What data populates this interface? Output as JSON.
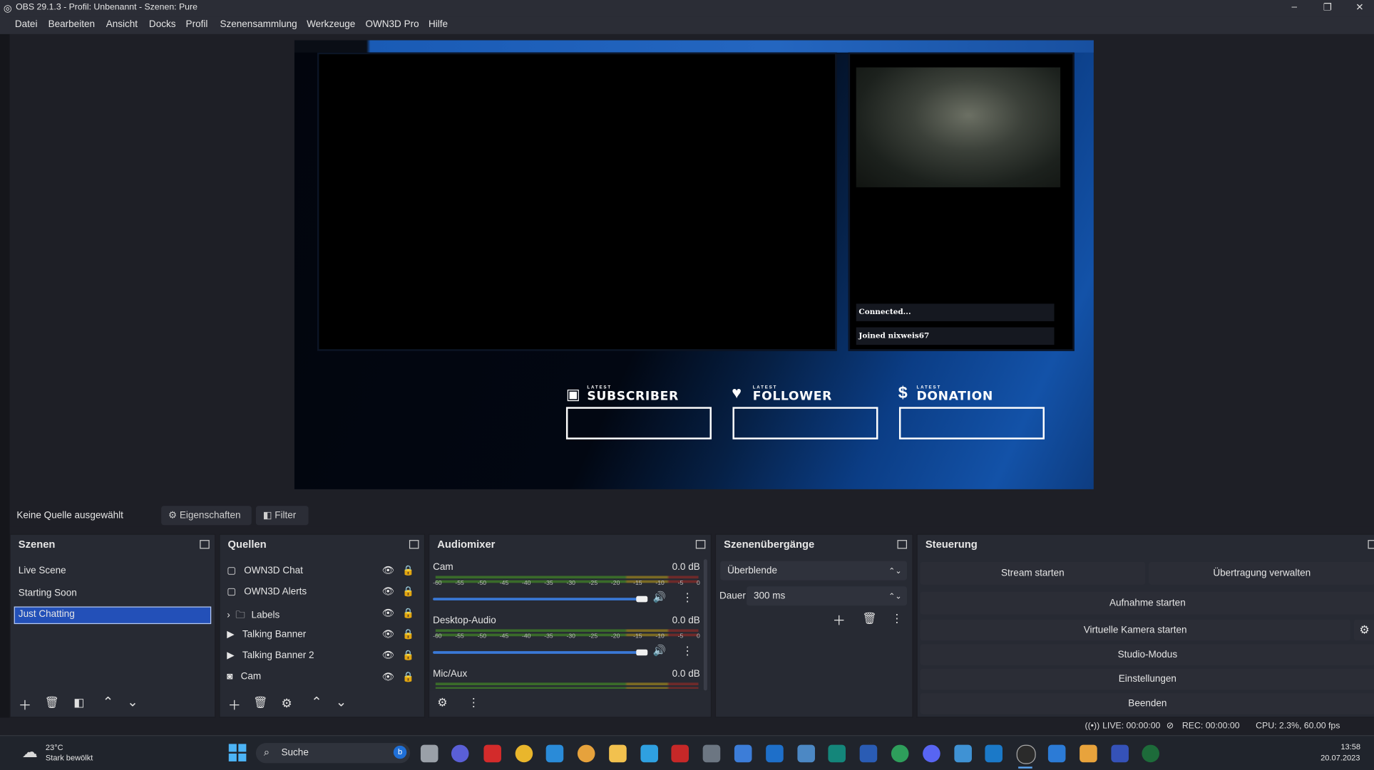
{
  "window": {
    "title": "OBS 29.1.3 - Profil: Unbenannt - Szenen: Pure"
  },
  "menu": [
    "Datei",
    "Bearbeiten",
    "Ansicht",
    "Docks",
    "Profil",
    "Szenensammlung",
    "Werkzeuge",
    "OWN3D Pro",
    "Hilfe"
  ],
  "preview": {
    "chat_lines": [
      "Connected...",
      "Joined nixweis67"
    ],
    "labels": {
      "small": "LATEST",
      "subscriber": "SUBSCRIBER",
      "follower": "FOLLOWER",
      "donation": "DONATION"
    }
  },
  "props": {
    "no_source": "Keine Quelle ausgewählt",
    "properties": "Eigenschaften",
    "filter": "Filter"
  },
  "scenes": {
    "title": "Szenen",
    "items": [
      "Live Scene",
      "Starting Soon",
      "Just Chatting"
    ],
    "selected": "Just Chatting"
  },
  "sources": {
    "title": "Quellen",
    "items": [
      {
        "name": "OWN3D Chat",
        "icon": "page-icon"
      },
      {
        "name": "OWN3D Alerts",
        "icon": "page-icon"
      },
      {
        "name": "Labels",
        "icon": "folder-icon"
      },
      {
        "name": "Talking Banner",
        "icon": "play-icon"
      },
      {
        "name": "Talking Banner 2",
        "icon": "play-icon"
      },
      {
        "name": "Cam",
        "icon": "camera-icon"
      }
    ]
  },
  "audio": {
    "title": "Audiomixer",
    "ticks": [
      "-60",
      "-55",
      "-50",
      "-45",
      "-40",
      "-35",
      "-30",
      "-25",
      "-20",
      "-15",
      "-10",
      "-5",
      "0"
    ],
    "channels": [
      {
        "name": "Cam",
        "db": "0.0 dB",
        "volume": 1.0
      },
      {
        "name": "Desktop-Audio",
        "db": "0.0 dB",
        "volume": 1.0
      },
      {
        "name": "Mic/Aux",
        "db": "0.0 dB",
        "volume": 1.0
      }
    ]
  },
  "transitions": {
    "title": "Szenenübergänge",
    "selected": "Überblende",
    "duration_label": "Dauer",
    "duration_value": "300 ms"
  },
  "controls": {
    "title": "Steuerung",
    "start_stream": "Stream starten",
    "manage_broadcast": "Übertragung verwalten",
    "start_recording": "Aufnahme starten",
    "start_virtual_cam": "Virtuelle Kamera starten",
    "studio_mode": "Studio-Modus",
    "settings": "Einstellungen",
    "exit": "Beenden"
  },
  "status": {
    "live": "LIVE: 00:00:00",
    "rec": "REC: 00:00:00",
    "cpu": "CPU: 2.3%, 60.00 fps"
  },
  "taskbar": {
    "weather_temp": "23°C",
    "weather_desc": "Stark bewölkt",
    "search": "Suche",
    "time": "13:58",
    "date": "20.07.2023"
  }
}
